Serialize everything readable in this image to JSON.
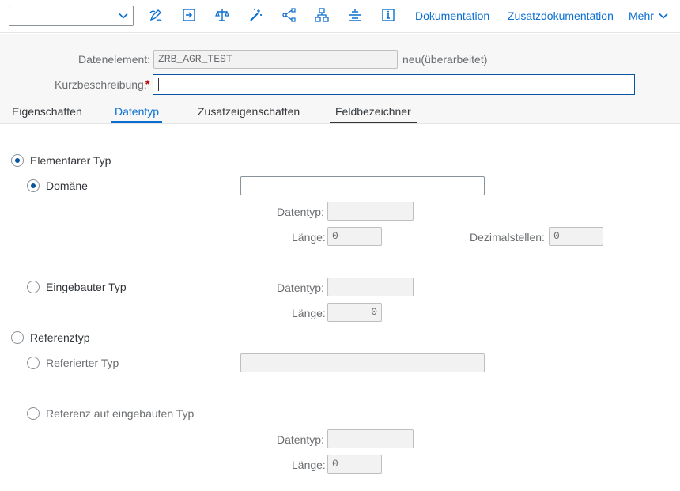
{
  "toolbar": {
    "command_field_value": "",
    "links": {
      "documentation": "Dokumentation",
      "additional_documentation": "Zusatzdokumentation",
      "more": "Mehr"
    },
    "icons": [
      "display-change-icon",
      "activate-icon",
      "balance-check-icon",
      "magic-wand-icon",
      "where-used-icon",
      "hierarchy-icon",
      "tree-align-icon",
      "info-icon"
    ]
  },
  "header": {
    "data_element_label": "Datenelement:",
    "data_element_value": "ZRB_AGR_TEST",
    "status": "neu(überarbeitet)",
    "short_description_label": "Kurzbeschreibung:",
    "required_marker": "*",
    "short_description_value": ""
  },
  "tabs": [
    {
      "label": "Eigenschaften",
      "active": false
    },
    {
      "label": "Datentyp",
      "active": true
    },
    {
      "label": "Zusatzeigenschaften",
      "active": false
    },
    {
      "label": "Feldbezeichner",
      "active": false
    }
  ],
  "content": {
    "elementary_type": {
      "label": "Elementarer Typ",
      "selected": true
    },
    "domain": {
      "label": "Domäne",
      "selected": true,
      "value": ""
    },
    "domain_datatype": {
      "label": "Datentyp:",
      "value": ""
    },
    "domain_length": {
      "label": "Länge:",
      "value": "0"
    },
    "domain_decimals": {
      "label": "Dezimalstellen:",
      "value": "0"
    },
    "builtin_type": {
      "label": "Eingebauter Typ",
      "selected": false
    },
    "builtin_datatype": {
      "label": "Datentyp:",
      "value": ""
    },
    "builtin_length": {
      "label": "Länge:",
      "value": "0"
    },
    "reference_type": {
      "label": "Referenztyp",
      "selected": false
    },
    "referenced_type": {
      "label": "Referierter Typ",
      "selected": false,
      "value": ""
    },
    "ref_builtin": {
      "label": "Referenz auf eingebauten Typ",
      "selected": false
    },
    "ref_datatype": {
      "label": "Datentyp:",
      "value": ""
    },
    "ref_length": {
      "label": "Länge:",
      "value": "0"
    }
  },
  "colors": {
    "accent": "#0a6ed1",
    "required": "#bb0000",
    "focus_border": "#0854a0"
  }
}
